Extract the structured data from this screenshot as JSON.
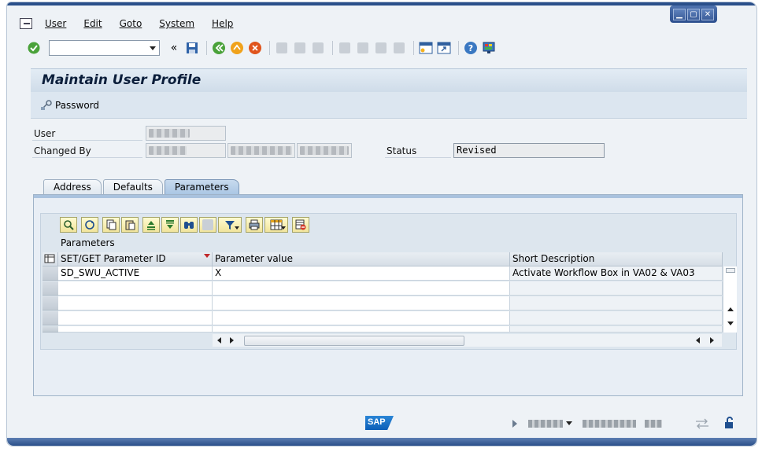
{
  "window_controls": {
    "minimize": "▁",
    "maximize": "▢",
    "close": "✕"
  },
  "menu": [
    "User",
    "Edit",
    "Goto",
    "System",
    "Help"
  ],
  "command_field": {
    "value": ""
  },
  "title": "Maintain User Profile",
  "app_toolbar": {
    "password_label": "Password"
  },
  "form": {
    "user_label": "User",
    "changed_by_label": "Changed By",
    "status_label": "Status",
    "status_value": "Revised"
  },
  "tabs": [
    {
      "label": "Address",
      "active": false
    },
    {
      "label": "Defaults",
      "active": false
    },
    {
      "label": "Parameters",
      "active": true
    }
  ],
  "grid": {
    "title": "Parameters",
    "columns": [
      "SET/GET Parameter ID",
      "Parameter value",
      "Short Description"
    ],
    "rows": [
      [
        "SD_SWU_ACTIVE",
        "X",
        "Activate Workflow Box in VA02 & VA03"
      ],
      [
        "",
        "",
        ""
      ],
      [
        "",
        "",
        ""
      ],
      [
        "",
        "",
        ""
      ],
      [
        "",
        "",
        ""
      ]
    ]
  },
  "statusbar": {
    "logo": "SAP"
  },
  "colors": {
    "accent": "#2a4f8a",
    "tab_active": "#a9c5e3",
    "toolbar_yellow": "#f1e49b"
  }
}
